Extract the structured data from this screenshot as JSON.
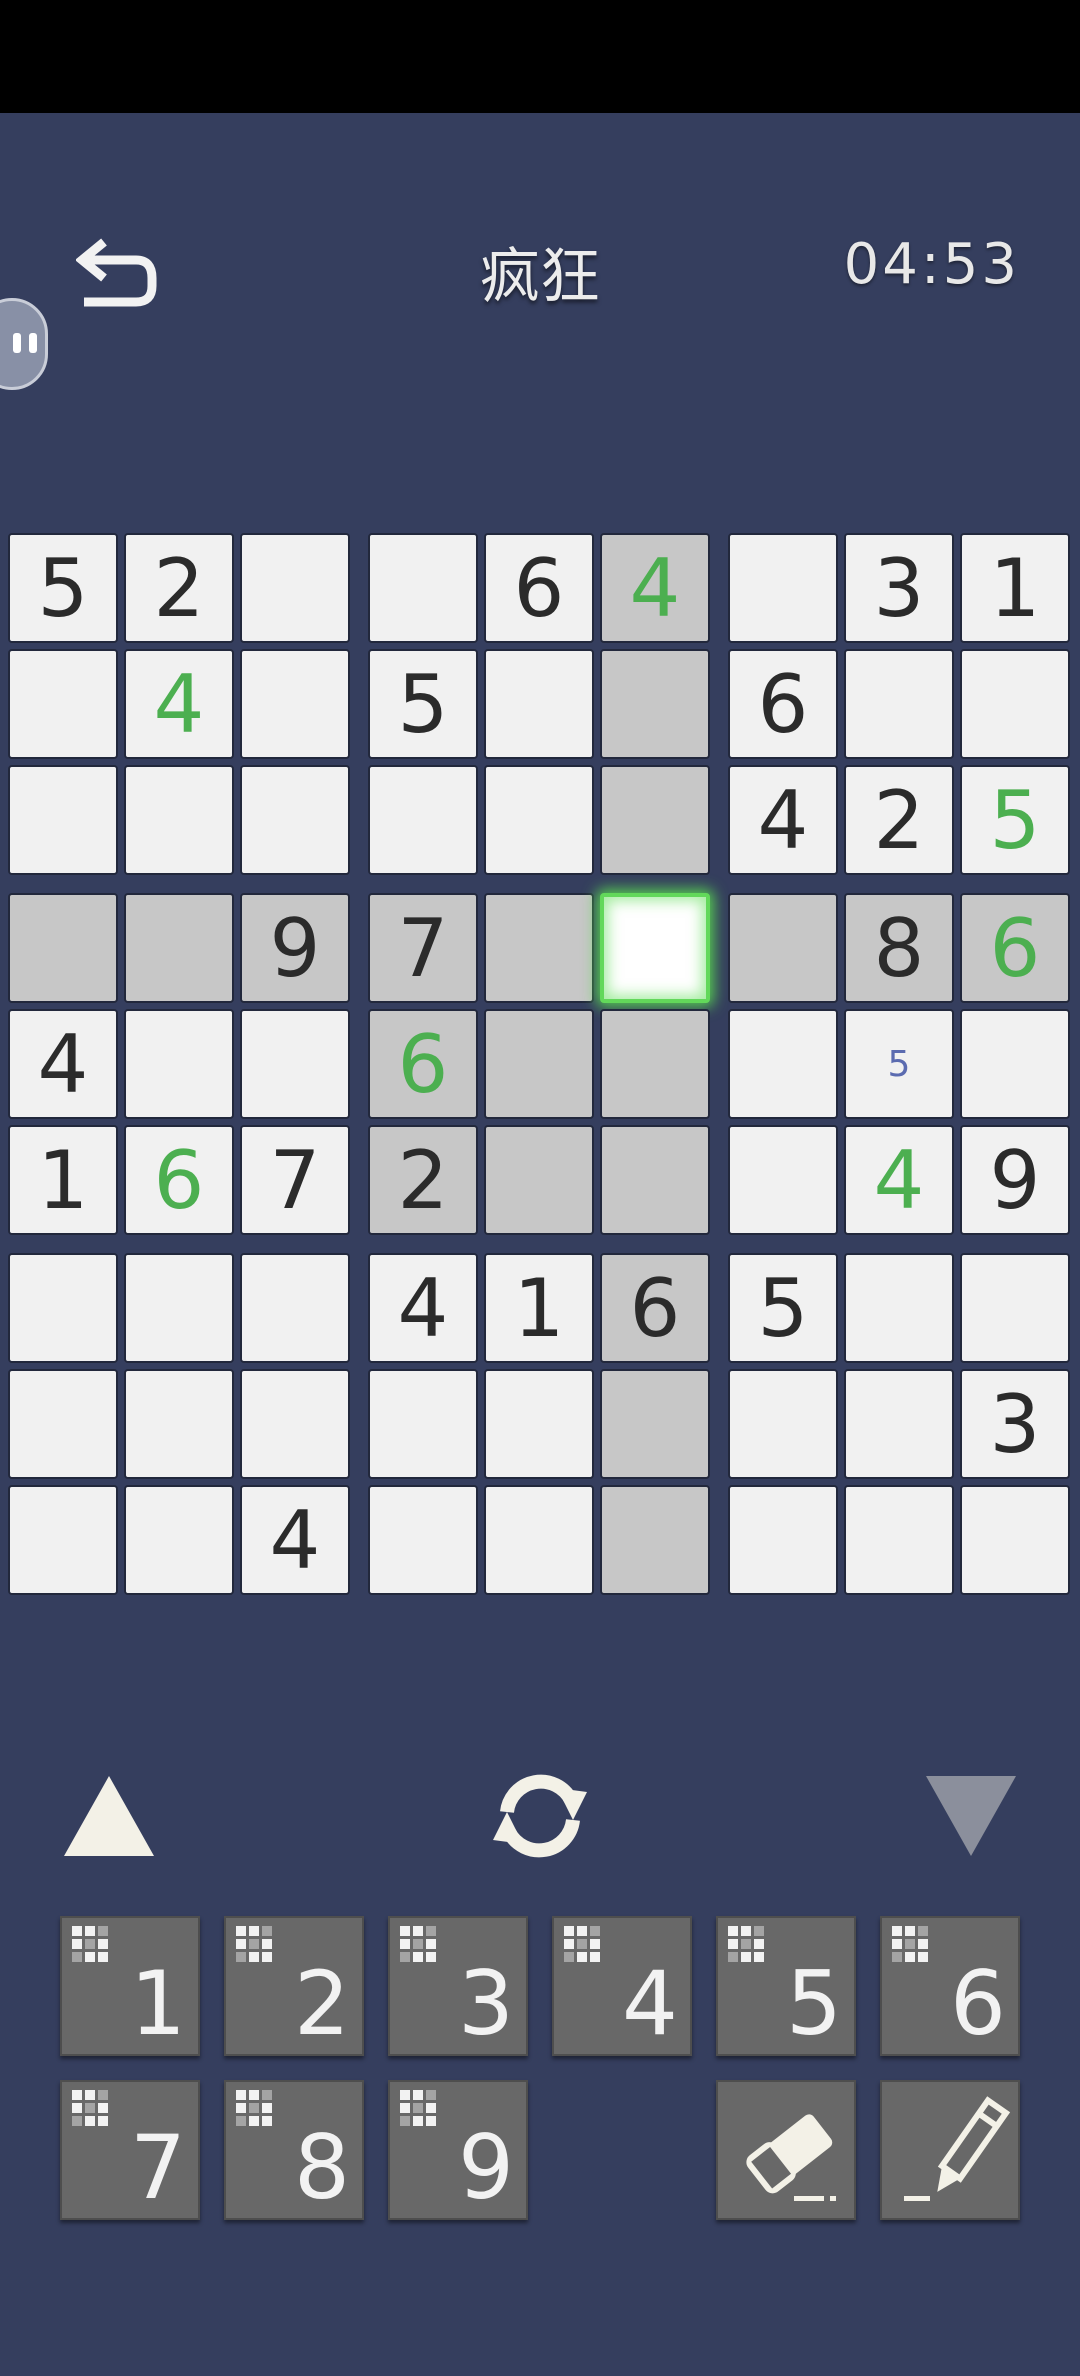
{
  "header": {
    "title": "疯狂",
    "timer": "04:53"
  },
  "board": [
    [
      "5",
      "2",
      "",
      "",
      "6",
      "4",
      "",
      "3",
      "1"
    ],
    [
      "",
      "4",
      "",
      "5",
      "",
      "",
      "6",
      "",
      ""
    ],
    [
      "",
      "",
      "",
      "",
      "",
      "",
      "4",
      "2",
      "5"
    ],
    [
      "",
      "",
      "9",
      "7",
      "",
      "",
      "",
      "8",
      "6"
    ],
    [
      "4",
      "",
      "",
      "6",
      "",
      "",
      "",
      "5",
      ""
    ],
    [
      "1",
      "6",
      "7",
      "2",
      "",
      "",
      "",
      "4",
      "9"
    ],
    [
      "",
      "",
      "",
      "4",
      "1",
      "6",
      "5",
      "",
      ""
    ],
    [
      "",
      "",
      "",
      "",
      "",
      "",
      "",
      "",
      "3"
    ],
    [
      "",
      "",
      "4",
      "",
      "",
      "",
      "",
      "",
      ""
    ]
  ],
  "user_entries": [
    [
      0,
      5
    ],
    [
      1,
      1
    ],
    [
      2,
      8
    ],
    [
      3,
      8
    ],
    [
      4,
      3
    ],
    [
      5,
      1
    ],
    [
      5,
      7
    ]
  ],
  "notes": [
    [
      4,
      7
    ]
  ],
  "highlighted": [
    [
      3,
      0
    ],
    [
      3,
      1
    ],
    [
      3,
      2
    ],
    [
      3,
      3
    ],
    [
      3,
      4
    ],
    [
      3,
      6
    ],
    [
      3,
      7
    ],
    [
      3,
      8
    ],
    [
      0,
      5
    ],
    [
      1,
      5
    ],
    [
      2,
      5
    ],
    [
      4,
      5
    ],
    [
      5,
      5
    ],
    [
      6,
      5
    ],
    [
      7,
      5
    ],
    [
      8,
      5
    ],
    [
      4,
      3
    ],
    [
      4,
      4
    ],
    [
      5,
      3
    ],
    [
      5,
      4
    ]
  ],
  "selected": [
    3,
    5
  ],
  "colors": {
    "background": "#353e5e",
    "given": "#2b2b2b",
    "user": "#4caf50",
    "note": "#5b6bb0",
    "selected_glow": "#62d85a",
    "highlight": "#c7c7c7",
    "key": "#686868"
  },
  "keypad": {
    "digits": [
      "1",
      "2",
      "3",
      "4",
      "5",
      "6",
      "7",
      "8",
      "9"
    ],
    "eraser_icon": "eraser-icon",
    "pencil_icon": "pencil-icon"
  },
  "tools": {
    "up_icon": "triangle-up-icon",
    "refresh_icon": "refresh-icon",
    "down_icon": "triangle-down-icon",
    "back_icon": "back-arrow-icon"
  }
}
